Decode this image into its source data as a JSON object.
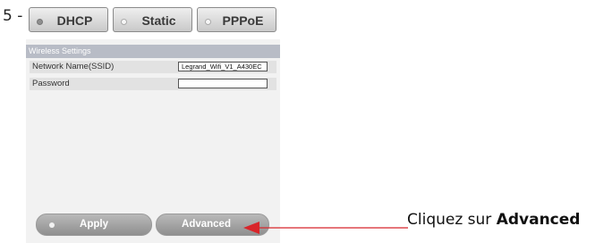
{
  "step": {
    "label": "5 -"
  },
  "modes": [
    {
      "label": "DHCP"
    },
    {
      "label": "Static"
    },
    {
      "label": "PPPoE"
    }
  ],
  "wireless": {
    "title": "Wireless Settings",
    "ssid_label": "Network Name(SSID)",
    "ssid_value": "Legrand_Wifi_V1_A430EC",
    "password_label": "Password",
    "password_value": ""
  },
  "actions": {
    "apply_label": "Apply",
    "advanced_label": "Advanced"
  },
  "callout": {
    "prefix": "Cliquez sur ",
    "emphasis": "Advanced"
  },
  "colors": {
    "arrow": "#d8252a",
    "panel": "#f2f2f2",
    "header": "#b8bcc6"
  }
}
